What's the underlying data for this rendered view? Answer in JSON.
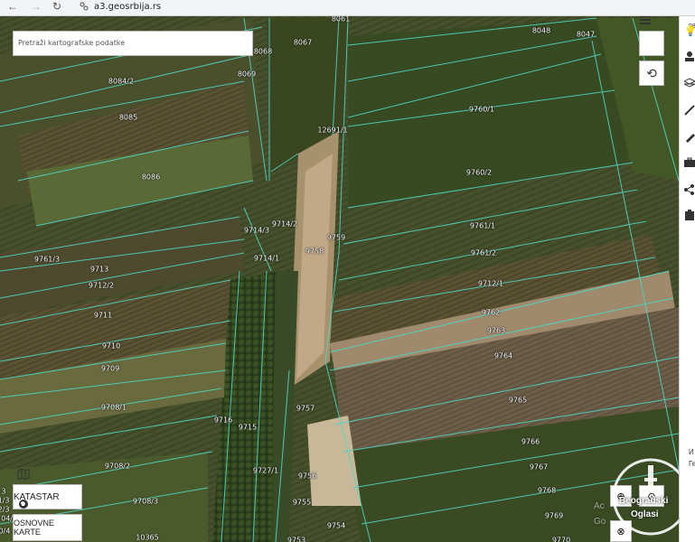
{
  "browser": {
    "url": "a3.geosrbija.rs"
  },
  "search": {
    "placeholder": "Pretraži kartografske podatke"
  },
  "buttons": {
    "katastar": "KATASTAR",
    "osnovne_line1": "OSNOVNE",
    "osnovne_line2": "KARTE"
  },
  "watermark": {
    "line1": "Beogradski",
    "line2": "Oglasi",
    "ghost1": "Ac",
    "ghost2": "Go"
  },
  "side_text": {
    "a": "98",
    "b": "И",
    "c": "Ге"
  },
  "left_edge_labels": [
    "3",
    "1/3",
    "2/3",
    "704/",
    "0/4"
  ],
  "parcels": [
    {
      "id": "8061"
    },
    {
      "id": "8067"
    },
    {
      "id": "8068"
    },
    {
      "id": "8069"
    },
    {
      "id": "8048"
    },
    {
      "id": "8047"
    },
    {
      "id": "8084/2"
    },
    {
      "id": "8085"
    },
    {
      "id": "8086"
    },
    {
      "id": "12691/1"
    },
    {
      "id": "9760/1"
    },
    {
      "id": "9760/2"
    },
    {
      "id": "9714/3"
    },
    {
      "id": "9714/2"
    },
    {
      "id": "9714/1"
    },
    {
      "id": "9758"
    },
    {
      "id": "9759"
    },
    {
      "id": "9761/1"
    },
    {
      "id": "9761/2"
    },
    {
      "id": "9761/3"
    },
    {
      "id": "9713"
    },
    {
      "id": "9712/2"
    },
    {
      "id": "9712/1"
    },
    {
      "id": "9711"
    },
    {
      "id": "9762"
    },
    {
      "id": "9763"
    },
    {
      "id": "9764"
    },
    {
      "id": "9710"
    },
    {
      "id": "9709"
    },
    {
      "id": "9765"
    },
    {
      "id": "9708/1"
    },
    {
      "id": "9757"
    },
    {
      "id": "9716"
    },
    {
      "id": "9715"
    },
    {
      "id": "9766"
    },
    {
      "id": "9708/2"
    },
    {
      "id": "9727/1"
    },
    {
      "id": "9756"
    },
    {
      "id": "9767"
    },
    {
      "id": "9768"
    },
    {
      "id": "9755"
    },
    {
      "id": "9708/3"
    },
    {
      "id": "9754"
    },
    {
      "id": "9769"
    },
    {
      "id": "10365"
    },
    {
      "id": "9753"
    },
    {
      "id": "9770"
    }
  ]
}
